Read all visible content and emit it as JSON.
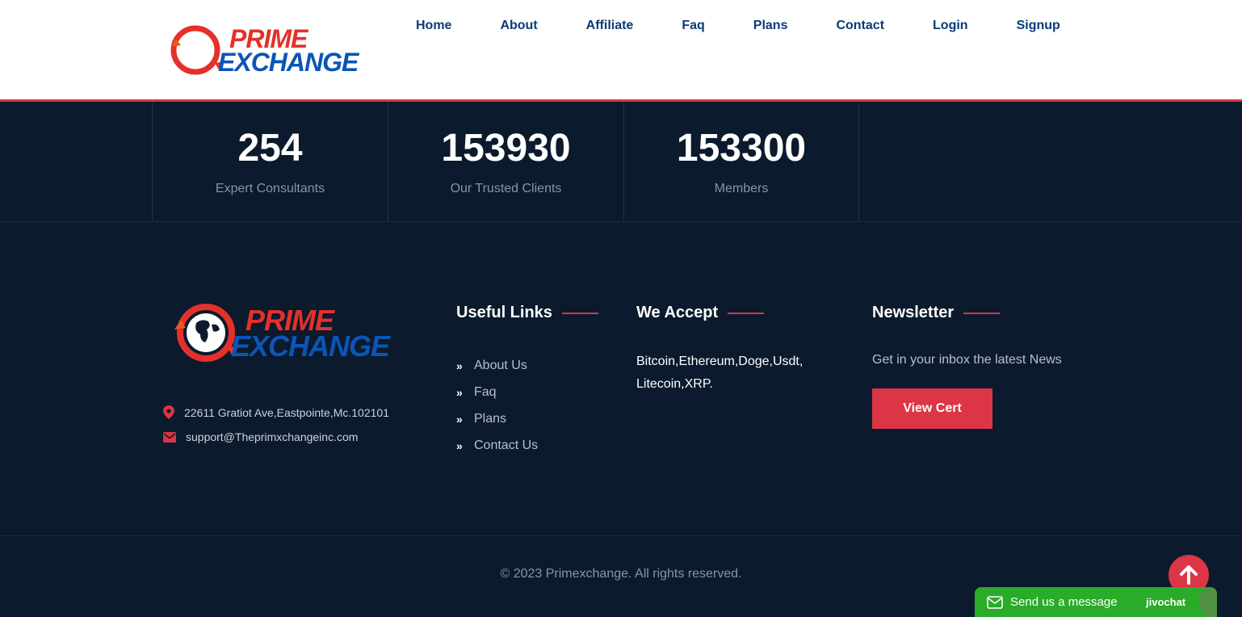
{
  "header": {
    "logo": {
      "line1": "PRIME",
      "line2": "EXCHANGE"
    },
    "nav": [
      "Home",
      "About",
      "Affiliate",
      "Faq",
      "Plans",
      "Contact",
      "Login",
      "Signup"
    ]
  },
  "stats": [
    {
      "value": "254",
      "label": "Expert Consultants"
    },
    {
      "value": "153930",
      "label": "Our Trusted Clients"
    },
    {
      "value": "153300",
      "label": "Members"
    }
  ],
  "footer": {
    "logo": {
      "line1": "PRIME",
      "line2": "EXCHANGE"
    },
    "address": "22611 Gratiot Ave,Eastpointe,Mc.102101",
    "email": "support@Theprimxchangeinc.com",
    "useful_links": {
      "title": "Useful Links",
      "items": [
        "About Us",
        "Faq",
        "Plans",
        "Contact Us"
      ]
    },
    "accept": {
      "title": "We Accept",
      "text": "Bitcoin,Ethereum,Doge,Usdt, Litecoin,XRP."
    },
    "newsletter": {
      "title": "Newsletter",
      "text": "Get in your inbox the latest News",
      "button": "View Cert"
    },
    "copyright": "© 2023 Primexchange. All rights reserved."
  },
  "widgets": {
    "chat_label": "Send us a message",
    "chat_brand": "jivochat"
  },
  "colors": {
    "accent": "#dc3545",
    "navy": "#0b1a2c",
    "nav_text": "#0b3a74",
    "logo_red": "#e5302a",
    "logo_blue": "#0b55b7",
    "chat_green": "#2aab2a"
  }
}
